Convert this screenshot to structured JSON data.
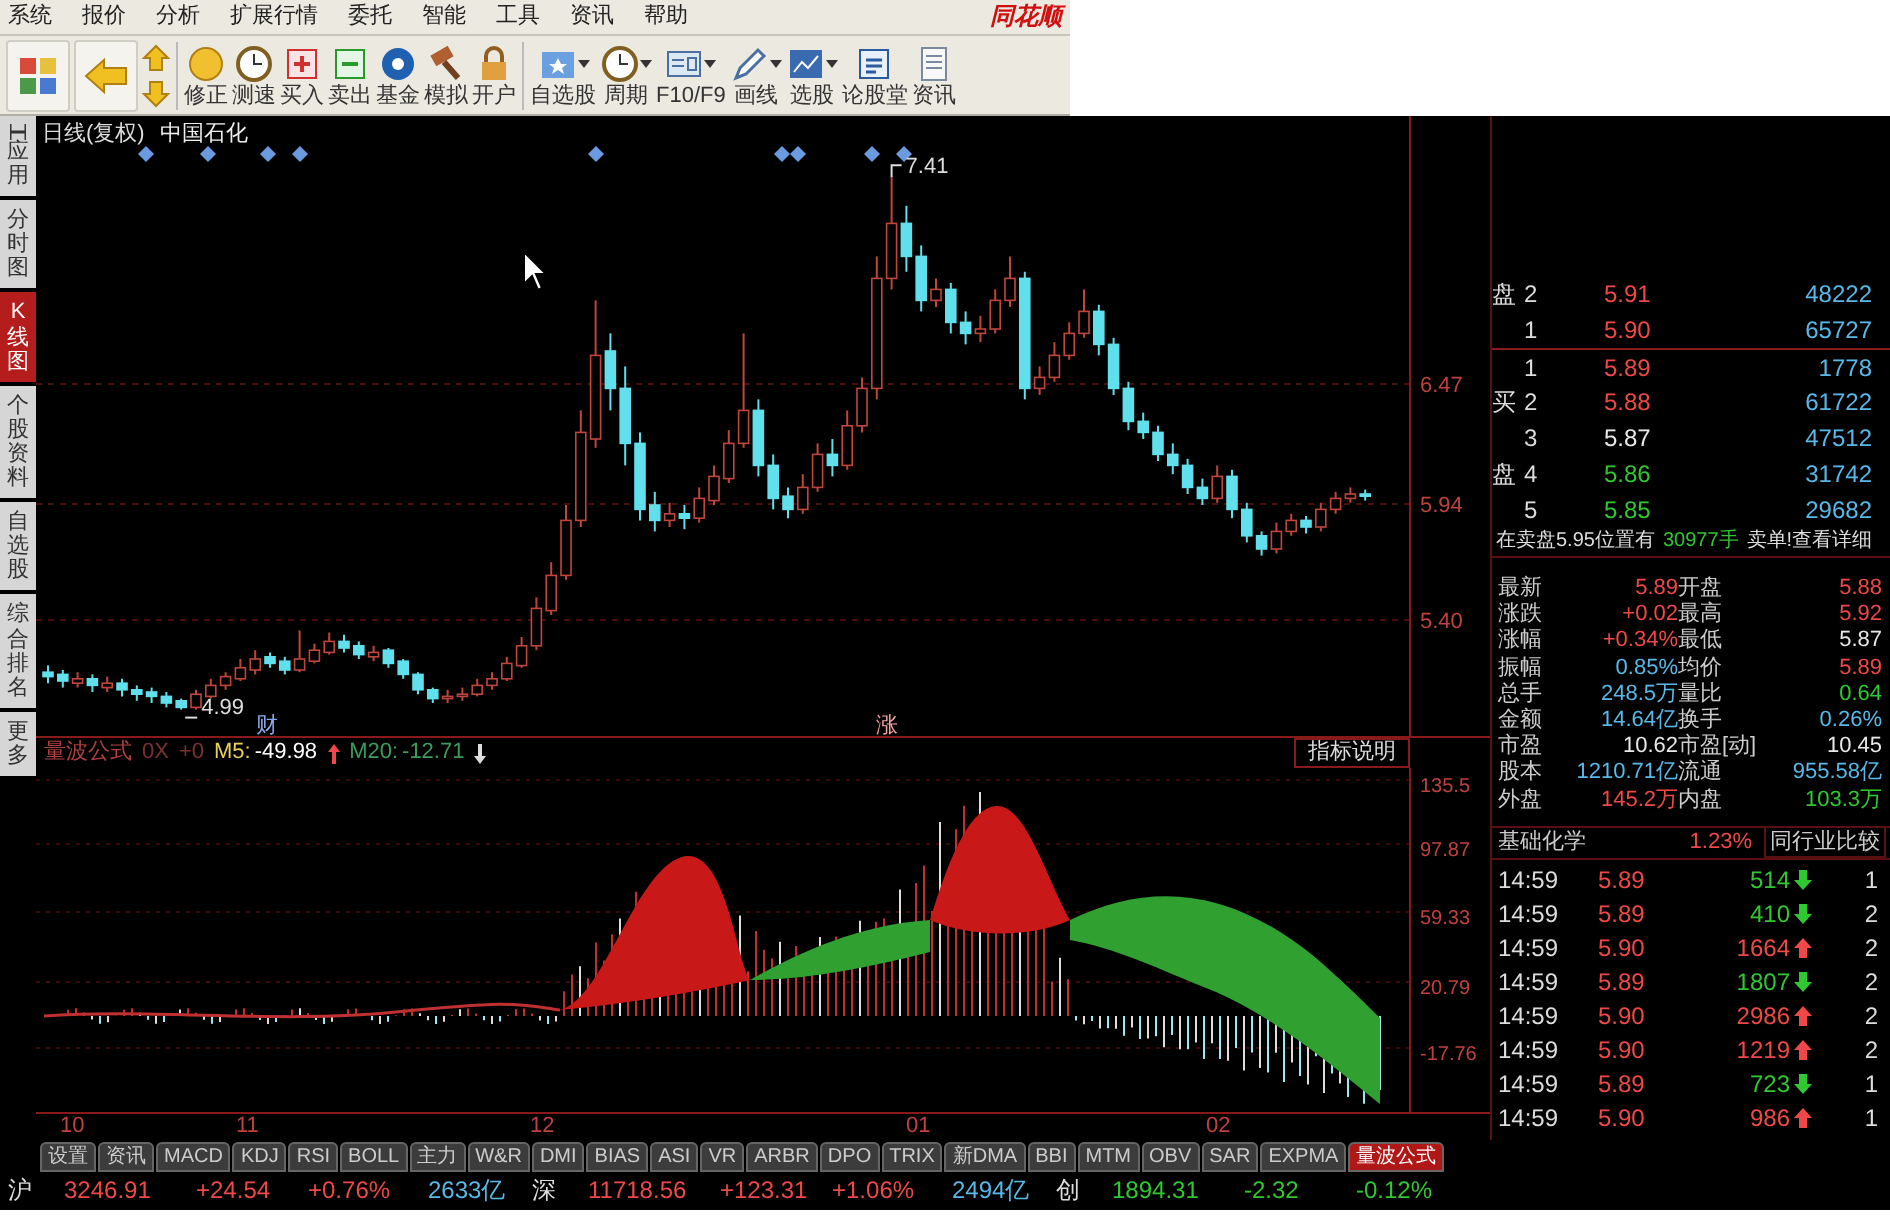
{
  "menu": [
    "系统",
    "报价",
    "分析",
    "扩展行情",
    "委托",
    "智能",
    "工具",
    "资讯",
    "帮助"
  ],
  "logo": "同花顺",
  "toolbar": [
    {
      "label": "修正",
      "dropdown": false
    },
    {
      "label": "测速",
      "dropdown": false
    },
    {
      "label": "买入",
      "dropdown": false
    },
    {
      "label": "卖出",
      "dropdown": false
    },
    {
      "label": "基金",
      "dropdown": false
    },
    {
      "label": "模拟",
      "dropdown": false
    },
    {
      "label": "开户",
      "dropdown": false
    },
    {
      "label": "自选股",
      "dropdown": true
    },
    {
      "label": "周期",
      "dropdown": true
    },
    {
      "label": "F10/F9",
      "dropdown": true
    },
    {
      "label": "画线",
      "dropdown": true
    },
    {
      "label": "选股",
      "dropdown": true
    },
    {
      "label": "论股堂",
      "dropdown": false
    },
    {
      "label": "资讯",
      "dropdown": false
    }
  ],
  "side_tabs": [
    {
      "label": "应用",
      "selected": false
    },
    {
      "label": "分时图",
      "selected": false
    },
    {
      "label": "K线图",
      "selected": true
    },
    {
      "label": "个股资料",
      "selected": false
    },
    {
      "label": "自选股",
      "selected": false
    },
    {
      "label": "综合排名",
      "selected": false
    },
    {
      "label": "更多",
      "selected": false
    }
  ],
  "chart": {
    "period": "日线(复权)",
    "stock": "中国石化",
    "high_label": "7.41",
    "low_label": "4.99",
    "price_labels": [
      "6.47",
      "5.94",
      "5.40"
    ],
    "event_markers": [
      "财",
      "涨"
    ],
    "chart_data": {
      "type": "candlestick",
      "ohlc": [
        [
          5.16,
          5.19,
          5.11,
          5.14
        ],
        [
          5.15,
          5.17,
          5.09,
          5.12
        ],
        [
          5.11,
          5.16,
          5.09,
          5.13
        ],
        [
          5.13,
          5.15,
          5.07,
          5.1
        ],
        [
          5.09,
          5.14,
          5.07,
          5.11
        ],
        [
          5.11,
          5.13,
          5.05,
          5.08
        ],
        [
          5.08,
          5.1,
          5.03,
          5.06
        ],
        [
          5.07,
          5.09,
          5.02,
          5.05
        ],
        [
          5.05,
          5.07,
          5.0,
          5.02
        ],
        [
          5.03,
          5.04,
          4.99,
          5.0
        ],
        [
          5.0,
          5.08,
          4.99,
          5.06
        ],
        [
          5.05,
          5.13,
          5.04,
          5.1
        ],
        [
          5.1,
          5.16,
          5.08,
          5.14
        ],
        [
          5.13,
          5.22,
          5.12,
          5.18
        ],
        [
          5.17,
          5.26,
          5.15,
          5.22
        ],
        [
          5.23,
          5.25,
          5.18,
          5.2
        ],
        [
          5.21,
          5.23,
          5.15,
          5.17
        ],
        [
          5.17,
          5.35,
          5.16,
          5.22
        ],
        [
          5.21,
          5.29,
          5.2,
          5.26
        ],
        [
          5.25,
          5.34,
          5.24,
          5.3
        ],
        [
          5.3,
          5.33,
          5.25,
          5.27
        ],
        [
          5.28,
          5.3,
          5.22,
          5.24
        ],
        [
          5.23,
          5.28,
          5.21,
          5.25
        ],
        [
          5.26,
          5.27,
          5.18,
          5.2
        ],
        [
          5.21,
          5.22,
          5.13,
          5.15
        ],
        [
          5.15,
          5.16,
          5.06,
          5.08
        ],
        [
          5.08,
          5.09,
          5.02,
          5.04
        ],
        [
          5.04,
          5.08,
          5.02,
          5.05
        ],
        [
          5.05,
          5.09,
          5.03,
          5.06
        ],
        [
          5.06,
          5.13,
          5.05,
          5.1
        ],
        [
          5.1,
          5.16,
          5.08,
          5.13
        ],
        [
          5.13,
          5.23,
          5.12,
          5.2
        ],
        [
          5.19,
          5.32,
          5.18,
          5.28
        ],
        [
          5.28,
          5.5,
          5.26,
          5.45
        ],
        [
          5.44,
          5.66,
          5.42,
          5.6
        ],
        [
          5.6,
          5.92,
          5.58,
          5.85
        ],
        [
          5.85,
          6.35,
          5.82,
          6.25
        ],
        [
          6.22,
          6.85,
          6.18,
          6.6
        ],
        [
          6.62,
          6.7,
          6.35,
          6.45
        ],
        [
          6.45,
          6.55,
          6.1,
          6.2
        ],
        [
          6.2,
          6.25,
          5.85,
          5.9
        ],
        [
          5.92,
          5.98,
          5.8,
          5.85
        ],
        [
          5.85,
          5.93,
          5.82,
          5.88
        ],
        [
          5.88,
          5.92,
          5.81,
          5.86
        ],
        [
          5.86,
          6.0,
          5.84,
          5.95
        ],
        [
          5.94,
          6.1,
          5.92,
          6.05
        ],
        [
          6.04,
          6.26,
          6.02,
          6.2
        ],
        [
          6.2,
          6.7,
          6.18,
          6.35
        ],
        [
          6.35,
          6.4,
          6.05,
          6.1
        ],
        [
          6.1,
          6.15,
          5.9,
          5.95
        ],
        [
          5.96,
          6.0,
          5.86,
          5.9
        ],
        [
          5.9,
          6.06,
          5.88,
          6.0
        ],
        [
          6.0,
          6.2,
          5.98,
          6.15
        ],
        [
          6.15,
          6.22,
          6.05,
          6.1
        ],
        [
          6.1,
          6.35,
          6.08,
          6.28
        ],
        [
          6.28,
          6.5,
          6.25,
          6.45
        ],
        [
          6.45,
          7.05,
          6.4,
          6.95
        ],
        [
          6.95,
          7.41,
          6.9,
          7.2
        ],
        [
          7.2,
          7.28,
          6.98,
          7.05
        ],
        [
          7.05,
          7.1,
          6.8,
          6.85
        ],
        [
          6.85,
          6.95,
          6.82,
          6.9
        ],
        [
          6.9,
          6.93,
          6.7,
          6.75
        ],
        [
          6.75,
          6.8,
          6.65,
          6.7
        ],
        [
          6.7,
          6.78,
          6.66,
          6.72
        ],
        [
          6.72,
          6.9,
          6.7,
          6.85
        ],
        [
          6.85,
          7.05,
          6.82,
          6.95
        ],
        [
          6.95,
          6.98,
          6.4,
          6.45
        ],
        [
          6.45,
          6.55,
          6.42,
          6.5
        ],
        [
          6.5,
          6.66,
          6.48,
          6.6
        ],
        [
          6.6,
          6.75,
          6.58,
          6.7
        ],
        [
          6.7,
          6.9,
          6.68,
          6.8
        ],
        [
          6.8,
          6.83,
          6.6,
          6.65
        ],
        [
          6.65,
          6.68,
          6.42,
          6.45
        ],
        [
          6.45,
          6.48,
          6.26,
          6.3
        ],
        [
          6.3,
          6.34,
          6.22,
          6.25
        ],
        [
          6.25,
          6.28,
          6.12,
          6.15
        ],
        [
          6.15,
          6.2,
          6.06,
          6.1
        ],
        [
          6.1,
          6.13,
          5.97,
          6.0
        ],
        [
          6.0,
          6.04,
          5.92,
          5.95
        ],
        [
          5.95,
          6.1,
          5.93,
          6.05
        ],
        [
          6.05,
          6.08,
          5.86,
          5.9
        ],
        [
          5.9,
          5.93,
          5.75,
          5.78
        ],
        [
          5.78,
          5.8,
          5.69,
          5.72
        ],
        [
          5.72,
          5.84,
          5.7,
          5.8
        ],
        [
          5.8,
          5.88,
          5.78,
          5.85
        ],
        [
          5.85,
          5.87,
          5.79,
          5.82
        ],
        [
          5.82,
          5.93,
          5.8,
          5.9
        ],
        [
          5.9,
          5.98,
          5.88,
          5.95
        ],
        [
          5.95,
          6.0,
          5.93,
          5.97
        ],
        [
          5.97,
          5.99,
          5.94,
          5.96
        ]
      ]
    }
  },
  "indicator": {
    "name": "量波公式",
    "params": [
      "0X",
      "+0"
    ],
    "lines": [
      {
        "label": "M5:",
        "value": "-49.98",
        "rising": true,
        "color": "#e8d050"
      },
      {
        "label": "M20:",
        "value": "-12.71",
        "rising": false,
        "color": "#3c9c5c"
      }
    ],
    "help_button": "指标说明",
    "axis_labels": [
      "135.5",
      "97.87",
      "59.33",
      "20.79",
      "-17.76"
    ]
  },
  "x_axis_labels": [
    "10",
    "11",
    "12",
    "01",
    "02"
  ],
  "order_book": [
    {
      "side": "盘",
      "level": "2",
      "price": "5.91",
      "volume": "48222",
      "color": "#f04848"
    },
    {
      "level": "1",
      "price": "5.90",
      "volume": "65727",
      "color": "#f04848"
    },
    {
      "level": "1",
      "price": "5.89",
      "volume": "1778",
      "color": "#f04848"
    },
    {
      "side": "买",
      "level": "2",
      "price": "5.88",
      "volume": "61722",
      "color": "#f04848"
    },
    {
      "level": "3",
      "price": "5.87",
      "volume": "47512",
      "color": "#e8e8e8"
    },
    {
      "side": "盘",
      "level": "4",
      "price": "5.86",
      "volume": "31742",
      "color": "#30c830"
    },
    {
      "level": "5",
      "price": "5.85",
      "volume": "29682",
      "color": "#30c830"
    }
  ],
  "order_notice": {
    "text": "在卖盘5.95位置有",
    "volume": "30977手",
    "link": "卖单!查看详细"
  },
  "stats": [
    {
      "label": "最新",
      "value": "5.89",
      "color": "#f04848"
    },
    {
      "label": "开盘",
      "value": "5.88",
      "color": "#f04848"
    },
    {
      "label": "涨跌",
      "value": "+0.02",
      "color": "#f04848"
    },
    {
      "label": "最高",
      "value": "5.92",
      "color": "#f04848"
    },
    {
      "label": "涨幅",
      "value": "+0.34%",
      "color": "#f04848"
    },
    {
      "label": "最低",
      "value": "5.87",
      "color": "#e8e8e8"
    },
    {
      "label": "振幅",
      "value": "0.85%",
      "color": "#58b8e8"
    },
    {
      "label": "均价",
      "value": "5.89",
      "color": "#f04848"
    },
    {
      "label": "总手",
      "value": "248.5万",
      "color": "#58b8e8"
    },
    {
      "label": "量比",
      "value": "0.64",
      "color": "#30c830"
    },
    {
      "label": "金额",
      "value": "14.64亿",
      "color": "#58b8e8"
    },
    {
      "label": "换手",
      "value": "0.26%",
      "color": "#58b8e8"
    },
    {
      "label": "市盈",
      "value": "10.62",
      "color": "#e8e8e8"
    },
    {
      "label": "市盈[动]",
      "value": "10.45",
      "color": "#e8e8e8"
    },
    {
      "label": "股本",
      "value": "1210.71亿",
      "color": "#58b8e8"
    },
    {
      "label": "流通",
      "value": "955.58亿",
      "color": "#58b8e8"
    },
    {
      "label": "外盘",
      "value": "145.2万",
      "color": "#f04848"
    },
    {
      "label": "内盘",
      "value": "103.3万",
      "color": "#30c830"
    }
  ],
  "sector": {
    "name": "基础化学",
    "change": "1.23%",
    "compare_button": "同行业比较"
  },
  "ticks": [
    {
      "time": "14:59",
      "price": "5.89",
      "volume": "514",
      "rising": false,
      "column_5": "1"
    },
    {
      "time": "14:59",
      "price": "5.89",
      "volume": "410",
      "rising": false,
      "column_5": "2"
    },
    {
      "time": "14:59",
      "price": "5.90",
      "volume": "1664",
      "rising": true,
      "column_5": "2"
    },
    {
      "time": "14:59",
      "price": "5.89",
      "volume": "1807",
      "rising": false,
      "column_5": "2"
    },
    {
      "time": "14:59",
      "price": "5.90",
      "volume": "2986",
      "rising": true,
      "column_5": "2"
    },
    {
      "time": "14:59",
      "price": "5.90",
      "volume": "1219",
      "rising": true,
      "column_5": "2"
    },
    {
      "time": "14:59",
      "price": "5.89",
      "volume": "723",
      "rising": false,
      "column_5": "1"
    },
    {
      "time": "14:59",
      "price": "5.90",
      "volume": "986",
      "rising": true,
      "column_5": "1"
    }
  ],
  "indicator_tabs": [
    {
      "label": "设置",
      "selected": false
    },
    {
      "label": "资讯",
      "selected": false
    },
    {
      "label": "MACD",
      "selected": false
    },
    {
      "label": "KDJ",
      "selected": false
    },
    {
      "label": "RSI",
      "selected": false
    },
    {
      "label": "BOLL",
      "selected": false
    },
    {
      "label": "主力",
      "selected": false
    },
    {
      "label": "W&R",
      "selected": false
    },
    {
      "label": "DMI",
      "selected": false
    },
    {
      "label": "BIAS",
      "selected": false
    },
    {
      "label": "ASI",
      "selected": false
    },
    {
      "label": "VR",
      "selected": false
    },
    {
      "label": "ARBR",
      "selected": false
    },
    {
      "label": "DPO",
      "selected": false
    },
    {
      "label": "TRIX",
      "selected": false
    },
    {
      "label": "新DMA",
      "selected": false
    },
    {
      "label": "BBI",
      "selected": false
    },
    {
      "label": "MTM",
      "selected": false
    },
    {
      "label": "OBV",
      "selected": false
    },
    {
      "label": "SAR",
      "selected": false
    },
    {
      "label": "EXPMA",
      "selected": false
    },
    {
      "label": "量波公式",
      "selected": true
    }
  ],
  "market_status": [
    {
      "name": "沪",
      "index": "3246.91",
      "change": "+24.54",
      "percent": "+0.76%",
      "amount": "2633亿",
      "rising": true
    },
    {
      "name": "深",
      "index": "11718.56",
      "change": "+123.31",
      "percent": "+1.06%",
      "amount": "2494亿",
      "rising": true
    },
    {
      "name": "创",
      "index": "1894.31",
      "change": "-2.32",
      "percent": "-0.12%",
      "rising": false
    }
  ]
}
